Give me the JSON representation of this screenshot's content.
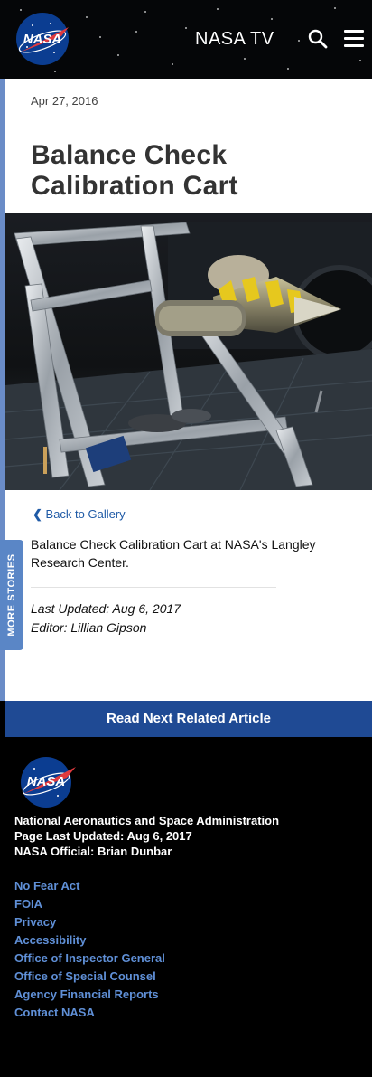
{
  "header": {
    "logo_text": "NASA",
    "nasa_tv": "NASA TV"
  },
  "article": {
    "date": "Apr 27, 2016",
    "title": "Balance Check Calibration Cart",
    "back_link": "Back to Gallery",
    "caption": "Balance Check Calibration Cart at NASA's Langley Research Center.",
    "last_updated": "Last Updated: Aug 6, 2017",
    "editor": "Editor: Lillian Gipson"
  },
  "more_stories": "MORE STORIES",
  "read_next": "Read Next Related Article",
  "footer": {
    "logo_text": "NASA",
    "agency_name": "National Aeronautics and Space Administration",
    "page_updated": "Page Last Updated: Aug 6, 2017",
    "official": "NASA Official: Brian Dunbar",
    "links": [
      "No Fear Act",
      "FOIA",
      "Privacy",
      "Accessibility",
      "Office of Inspector General",
      "Office of Special Counsel",
      "Agency Financial Reports",
      "Contact NASA"
    ]
  },
  "colors": {
    "nasa_blue": "#1f4a94",
    "link_blue": "#1f5aa6",
    "footer_link": "#5f8fd6",
    "side_tab": "#5a86c6"
  }
}
